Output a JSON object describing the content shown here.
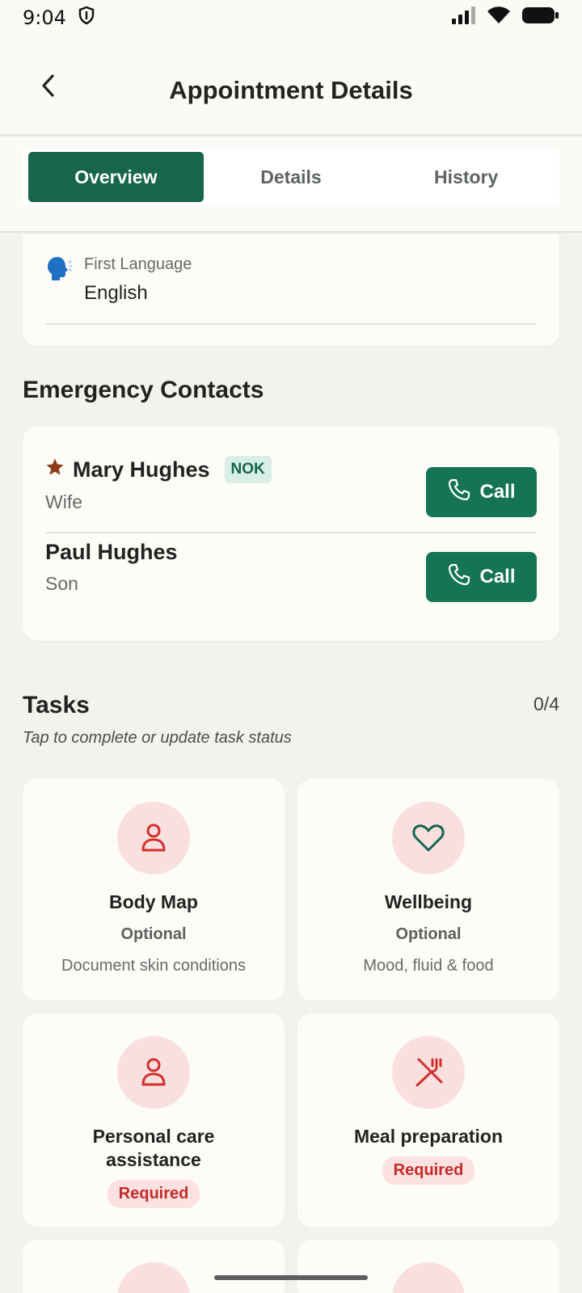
{
  "status_bar": {
    "time": "9:04"
  },
  "header": {
    "title": "Appointment Details"
  },
  "tabs": [
    {
      "label": "Overview",
      "active": true
    },
    {
      "label": "Details",
      "active": false
    },
    {
      "label": "History",
      "active": false
    }
  ],
  "language": {
    "label": "First Language",
    "value": "English"
  },
  "emergency": {
    "title": "Emergency Contacts",
    "contacts": [
      {
        "name": "Mary Hughes",
        "relation": "Wife",
        "badge": "NOK",
        "call_label": "Call"
      },
      {
        "name": "Paul Hughes",
        "relation": "Son",
        "call_label": "Call"
      }
    ]
  },
  "tasks": {
    "title": "Tasks",
    "count": "0/4",
    "subtitle": "Tap to complete or update task status",
    "items": [
      {
        "title": "Body Map",
        "status": "Optional",
        "description": "Document skin conditions",
        "icon": "person-icon"
      },
      {
        "title": "Wellbeing",
        "status": "Optional",
        "description": "Mood, fluid & food",
        "icon": "heart-icon"
      },
      {
        "title": "Personal care assistance",
        "status": "Required",
        "icon": "person-icon"
      },
      {
        "title": "Meal preparation",
        "status": "Required",
        "icon": "fork-knife-icon"
      }
    ]
  },
  "colors": {
    "primary": "#17654d",
    "required_text": "#c62a2a",
    "icon_bg": "#f9e0df"
  }
}
